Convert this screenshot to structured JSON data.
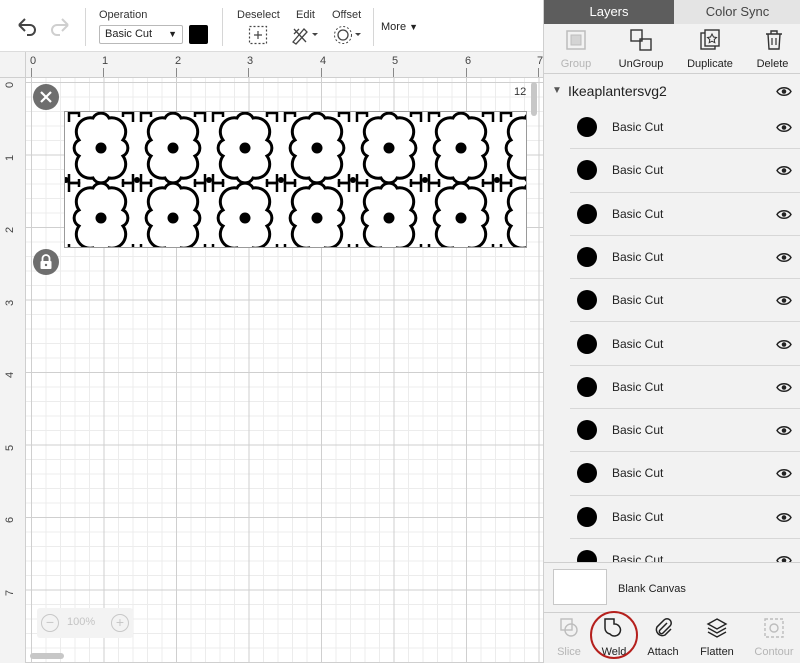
{
  "toolbar": {
    "operation_label": "Operation",
    "operation_value": "Basic Cut",
    "operation_color": "#000000",
    "deselect_label": "Deselect",
    "edit_label": "Edit",
    "offset_label": "Offset",
    "more_label": "More"
  },
  "canvas": {
    "ruler_top": [
      "0",
      "1",
      "2",
      "3",
      "4",
      "5",
      "6",
      "7"
    ],
    "ruler_left": [
      "0",
      "1",
      "2",
      "3",
      "4",
      "5",
      "6",
      "7"
    ],
    "size_label": "12",
    "zoom_level": "100%"
  },
  "panel": {
    "tabs": {
      "layers": "Layers",
      "color_sync": "Color Sync"
    },
    "actions": {
      "group": "Group",
      "ungroup": "UnGroup",
      "duplicate": "Duplicate",
      "delete": "Delete"
    },
    "group_name": "Ikeaplantersvg2",
    "layers": [
      {
        "name": "Basic Cut",
        "color": "#000000"
      },
      {
        "name": "Basic Cut",
        "color": "#000000"
      },
      {
        "name": "Basic Cut",
        "color": "#000000"
      },
      {
        "name": "Basic Cut",
        "color": "#000000"
      },
      {
        "name": "Basic Cut",
        "color": "#000000"
      },
      {
        "name": "Basic Cut",
        "color": "#000000"
      },
      {
        "name": "Basic Cut",
        "color": "#000000"
      },
      {
        "name": "Basic Cut",
        "color": "#000000"
      },
      {
        "name": "Basic Cut",
        "color": "#000000"
      },
      {
        "name": "Basic Cut",
        "color": "#000000"
      },
      {
        "name": "Basic Cut",
        "color": "#000000"
      }
    ],
    "blank_canvas_label": "Blank Canvas",
    "bottom_actions": {
      "slice": "Slice",
      "weld": "Weld",
      "attach": "Attach",
      "flatten": "Flatten",
      "contour": "Contour"
    },
    "highlight_color": "#b5201d"
  }
}
